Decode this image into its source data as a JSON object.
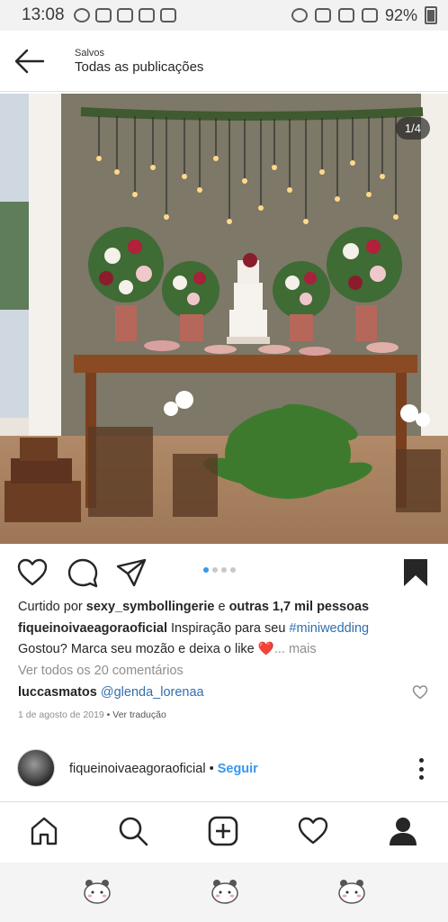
{
  "status_bar": {
    "time": "13:08",
    "battery": "92%"
  },
  "header": {
    "subtitle": "Salvos",
    "title": "Todas as publicações"
  },
  "post": {
    "image_counter": "1/4",
    "likes": {
      "prefix": "Curtido por ",
      "user": "sexy_symbollingerie",
      "middle": " e ",
      "others": "outras 1,7 mil pessoas"
    },
    "caption": {
      "author": "fiqueinoivaeagoraoficial",
      "text": " Inspiração para seu ",
      "hashtag": "#miniwedding",
      "line2": "Gostou? Marca seu mozão e deixa o like ❤️",
      "more": "... mais"
    },
    "view_comments": "Ver todos os 20 comentários",
    "comment": {
      "user": "luccasmatos",
      "mention": "@glenda_lorenaa"
    },
    "date": "1 de agosto de 2019",
    "translation": " • Ver tradução"
  },
  "author_bar": {
    "username": "fiqueinoivaeagoraoficial",
    "separator": " • ",
    "follow": "Seguir"
  },
  "carousel": {
    "total": 4,
    "active": 1
  },
  "colors": {
    "accent": "#3897f0",
    "link": "#2f6fb0",
    "heart": "#e0245e"
  }
}
